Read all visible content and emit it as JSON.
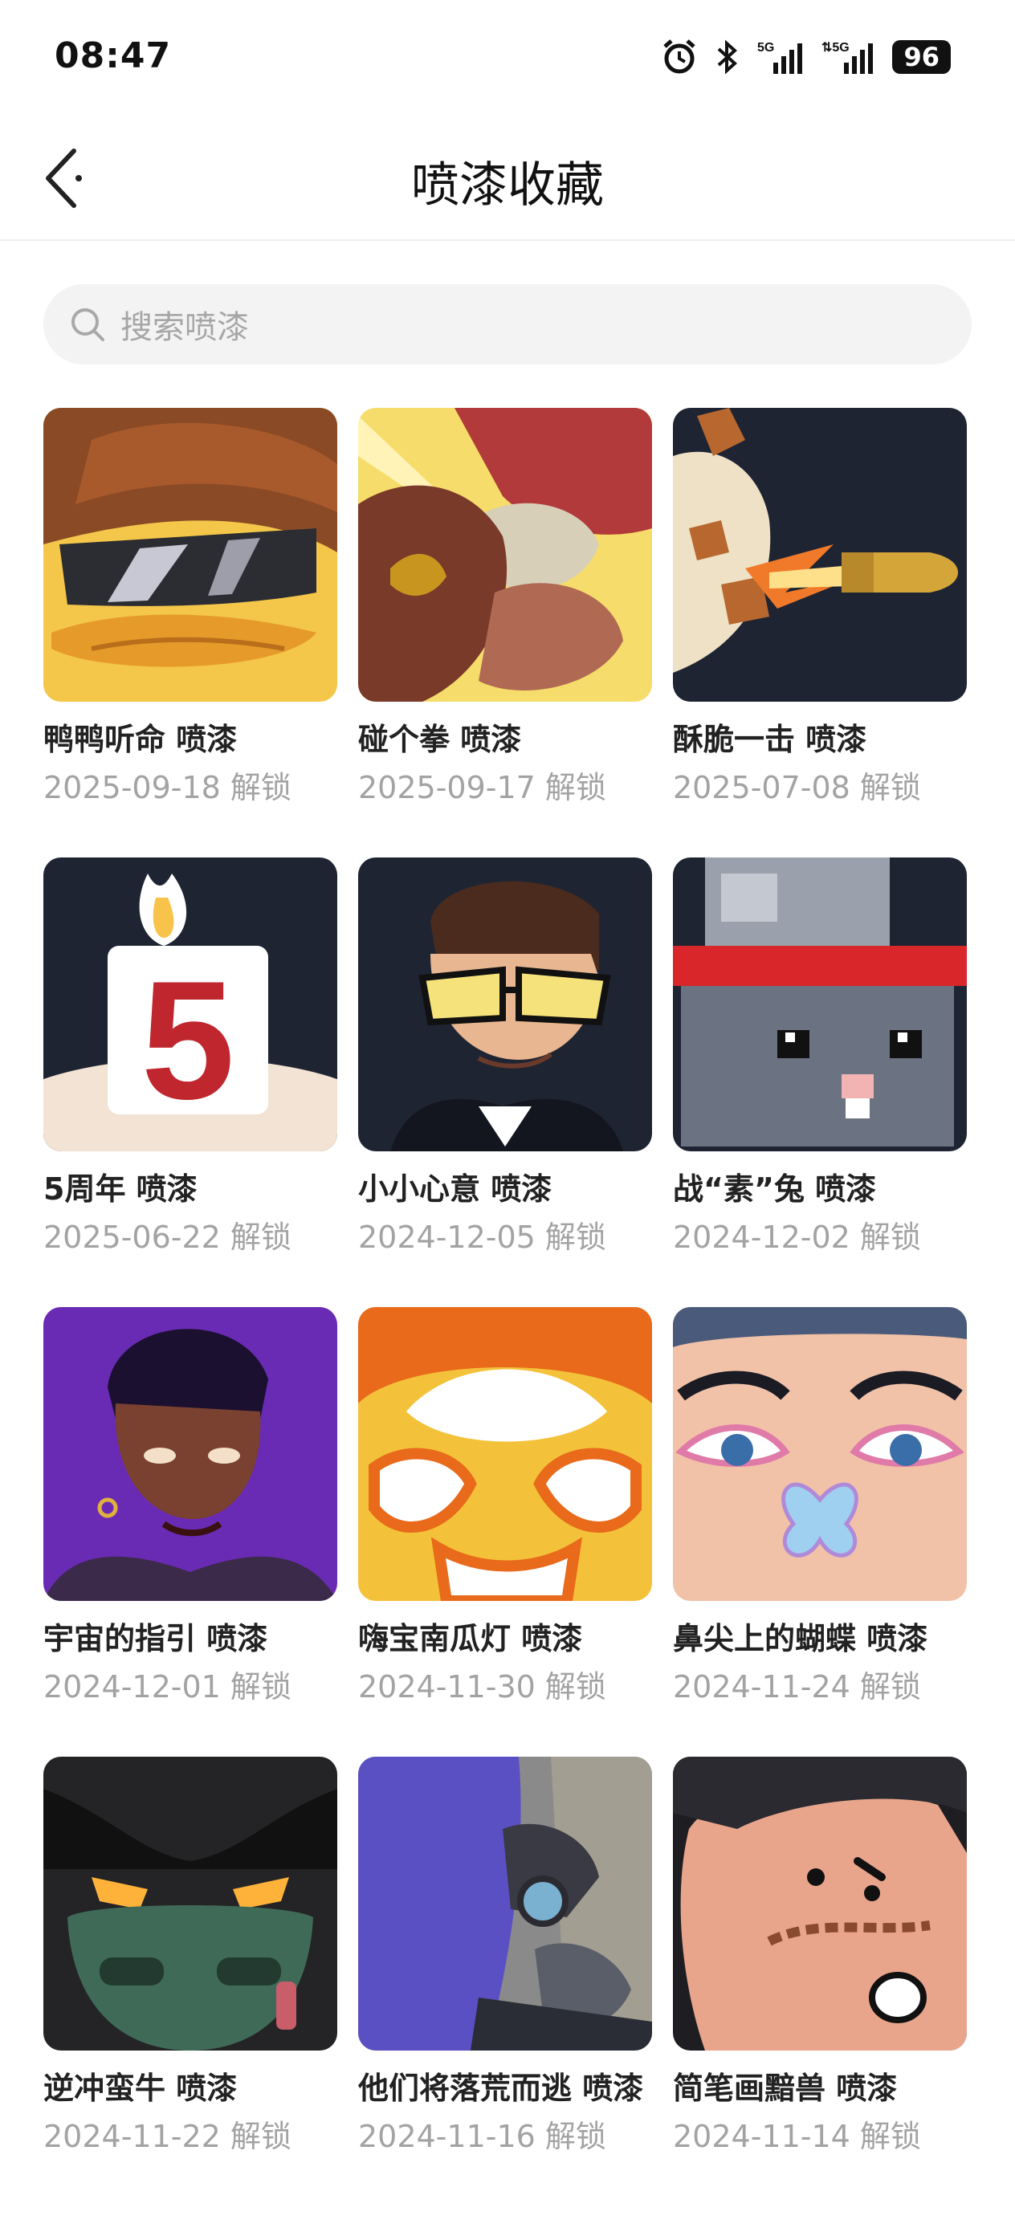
{
  "status_bar": {
    "time": "08:47",
    "battery": "96"
  },
  "header": {
    "title": "喷漆收藏"
  },
  "search": {
    "placeholder": "搜索喷漆"
  },
  "sprays": [
    {
      "name": "鸭鸭听命 喷漆",
      "date": "2025-09-18 解锁"
    },
    {
      "name": "碰个拳 喷漆",
      "date": "2025-09-17 解锁"
    },
    {
      "name": "酥脆一击 喷漆",
      "date": "2025-07-08 解锁"
    },
    {
      "name": "5周年 喷漆",
      "date": "2025-06-22 解锁"
    },
    {
      "name": "小小心意 喷漆",
      "date": "2024-12-05 解锁"
    },
    {
      "name": "战“素”兔 喷漆",
      "date": "2024-12-02 解锁"
    },
    {
      "name": "宇宙的指引 喷漆",
      "date": "2024-12-01 解锁"
    },
    {
      "name": "嗨宝南瓜灯 喷漆",
      "date": "2024-11-30 解锁"
    },
    {
      "name": "鼻尖上的蝴蝶 喷漆",
      "date": "2024-11-24 解锁"
    },
    {
      "name": "逆冲蛮牛 喷漆",
      "date": "2024-11-22 解锁"
    },
    {
      "name": "他们将落荒而逃 喷漆",
      "date": "2024-11-16 解锁"
    },
    {
      "name": "简笔画黯兽 喷漆",
      "date": "2024-11-14 解锁"
    }
  ],
  "thumb_digit": "5"
}
